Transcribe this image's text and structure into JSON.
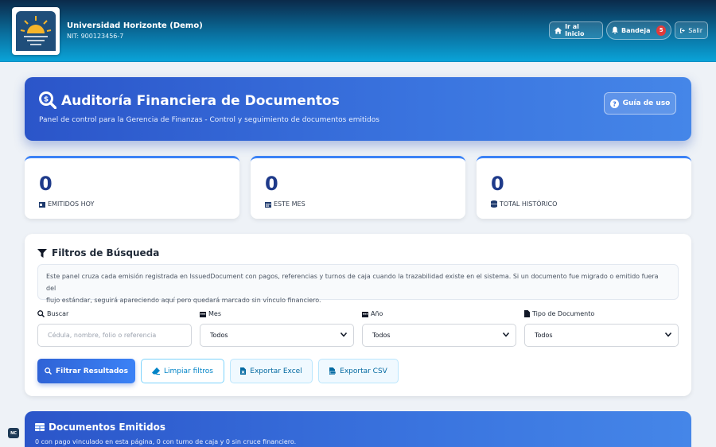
{
  "header": {
    "org_name": "Universidad Horizonte (Demo)",
    "nit": "NIT: 900123456-7",
    "home_label": "Ir al Inicio",
    "inbox_label": "Bandeja",
    "inbox_count": "5",
    "logout_label": "Salir"
  },
  "hero": {
    "title": "Auditoría Financiera de Documentos",
    "subtitle": "Panel de control para la Gerencia de Finanzas - Control y seguimiento de documentos emitidos",
    "guide_label": "Guía de uso"
  },
  "stats": [
    {
      "value": "0",
      "label": "EMITIDOS HOY"
    },
    {
      "value": "0",
      "label": "ESTE MES"
    },
    {
      "value": "0",
      "label": "TOTAL HISTÓRICO"
    }
  ],
  "filters": {
    "title": "Filtros de Búsqueda",
    "info_line1": "Este panel cruza cada emisión registrada en IssuedDocument con pagos, referencias y turnos de caja cuando la trazabilidad existe en el sistema. Si un documento fue migrado o emitido fuera del",
    "info_line2": "flujo estándar, seguirá apareciendo aquí pero quedará marcado sin vínculo financiero.",
    "search_label": "Buscar",
    "search_placeholder": "Cédula, nombre, folio o referencia",
    "month_label": "Mes",
    "month_value": "Todos",
    "year_label": "Año",
    "year_value": "Todos",
    "doctype_label": "Tipo de Documento",
    "doctype_value": "Todos",
    "filter_btn": "Filtrar Resultados",
    "clear_btn": "Limpiar filtros",
    "excel_btn": "Exportar Excel",
    "csv_btn": "Exportar CSV"
  },
  "documents": {
    "title": "Documentos Emitidos",
    "summary": "0 con pago vinculado en esta página, 0 con turno de caja y 0 sin cruce financiero."
  },
  "corner_badge": "NC"
}
